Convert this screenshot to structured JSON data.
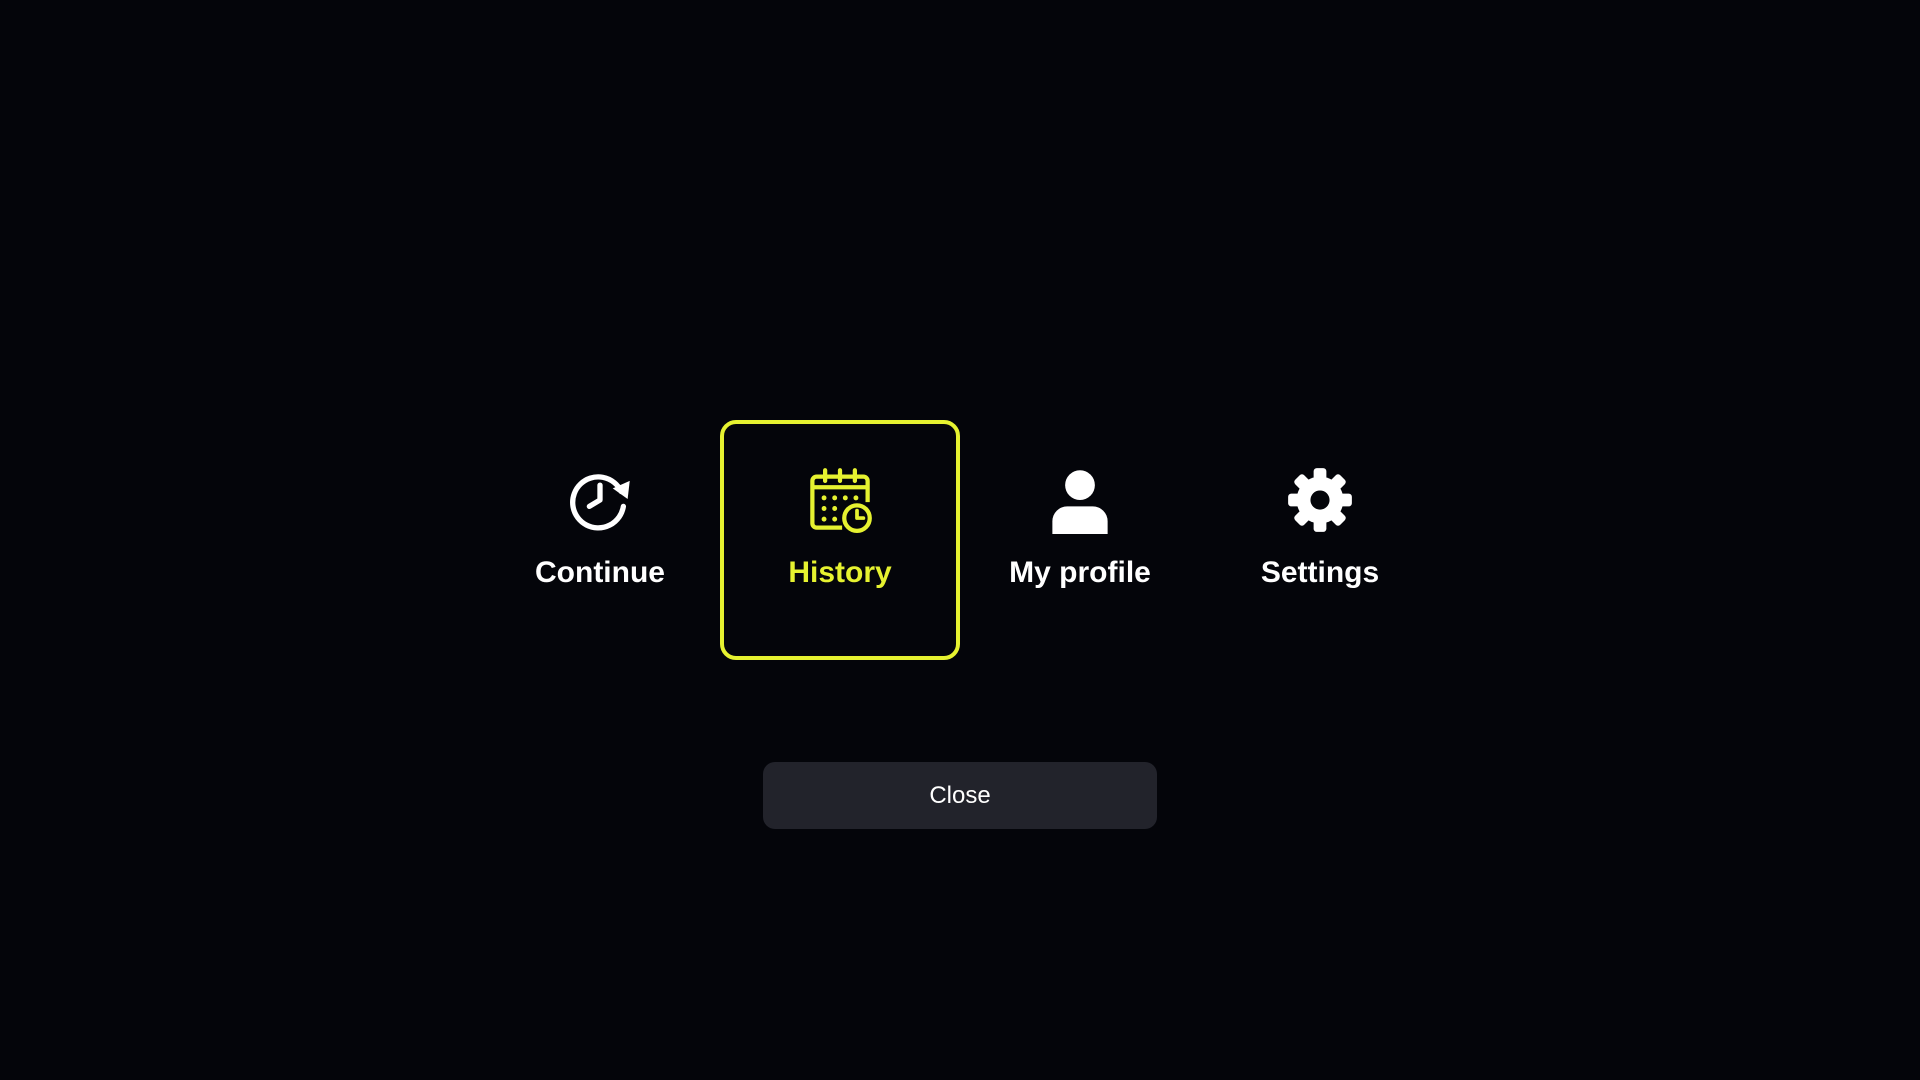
{
  "menu": {
    "items": [
      {
        "label": "Continue",
        "icon": "continue-clock-icon",
        "active": false
      },
      {
        "label": "History",
        "icon": "calendar-clock-icon",
        "active": true
      },
      {
        "label": "My profile",
        "icon": "person-icon",
        "active": false
      },
      {
        "label": "Settings",
        "icon": "gear-icon",
        "active": false
      }
    ]
  },
  "close_button": {
    "label": "Close"
  },
  "colors": {
    "background": "#04050a",
    "accent": "#e6f230",
    "text": "#ffffff",
    "button_bg": "#22232b"
  }
}
